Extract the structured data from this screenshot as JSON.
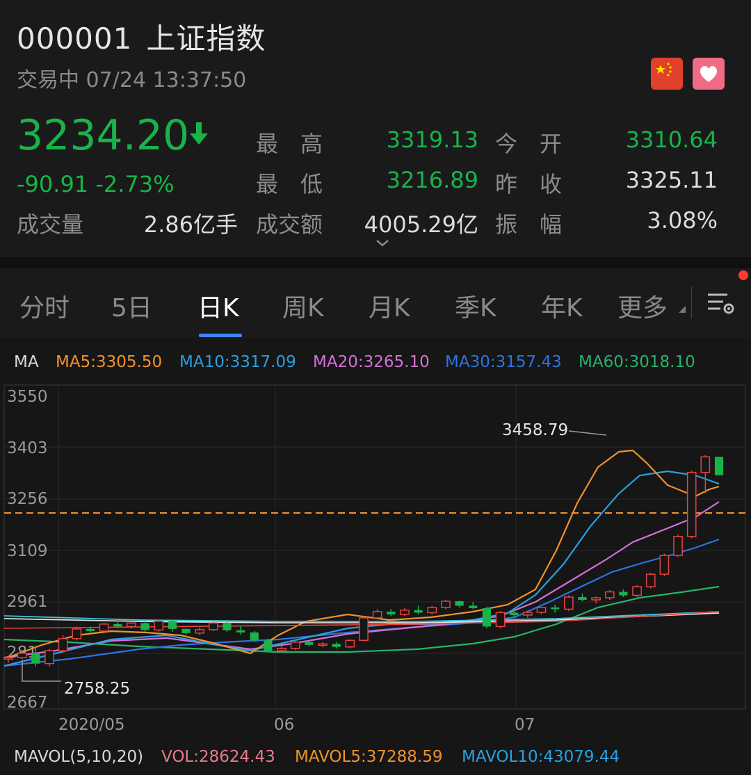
{
  "header": {
    "code": "000001",
    "name": "上证指数",
    "status": "交易中 07/24 13:37:50",
    "price": "3234.20",
    "change": "-90.91",
    "change_pct": "-2.73%",
    "icons": {
      "flag": "china-flag-icon",
      "favorite": "heart-icon",
      "price_direction": "down-arrow-icon"
    },
    "stats": {
      "high_label": "最　高",
      "high_value": "3319.13",
      "open_label": "今　开",
      "open_value": "3310.64",
      "low_label": "最　低",
      "low_value": "3216.89",
      "prev_close_label": "昨　收",
      "prev_close_value": "3325.11",
      "volume_label": "成交量",
      "volume_value": "2.86亿手",
      "turnover_label": "成交额",
      "turnover_value": "4005.29亿",
      "amplitude_label": "振　幅",
      "amplitude_value": "3.08%"
    }
  },
  "tabs": {
    "items": [
      "分时",
      "5日",
      "日K",
      "周K",
      "月K",
      "季K",
      "年K",
      "更多"
    ],
    "active": "日K"
  },
  "ma": {
    "label": "MA",
    "ma5": "MA5:3305.50",
    "ma10": "MA10:3317.09",
    "ma20": "MA20:3265.10",
    "ma30": "MA30:3157.43",
    "ma60": "MA60:3018.10"
  },
  "volume": {
    "label": "MAVOL(5,10,20)",
    "vol": "VOL:28624.43",
    "mavol5": "MAVOL5:37288.59",
    "mavol10": "MAVOL10:43079.44"
  },
  "colors": {
    "up": "#e8413c",
    "down": "#19b34a",
    "ma5": "#f0922c",
    "ma10": "#2a9fe0",
    "ma20": "#d66fd8",
    "ma30": "#2c74e0",
    "ma60": "#27b36b",
    "accent": "#3d86ff"
  },
  "chart_data": {
    "type": "candlestick",
    "y_ticks": [
      "3550",
      "3403",
      "3256",
      "3109",
      "2961",
      "281",
      "2667"
    ],
    "x_ticks": [
      "2020/05",
      "06",
      "07"
    ],
    "ylim": [
      2667,
      3550
    ],
    "annotations": {
      "high": "3458.79",
      "low": "2758.25"
    },
    "current_price": 3234.2,
    "ohlc": [
      [
        2792,
        2800,
        2780,
        2795
      ],
      [
        2795,
        2815,
        2790,
        2808
      ],
      [
        2808,
        2830,
        2770,
        2778
      ],
      [
        2778,
        2820,
        2770,
        2815
      ],
      [
        2815,
        2860,
        2810,
        2850
      ],
      [
        2850,
        2885,
        2845,
        2878
      ],
      [
        2878,
        2885,
        2868,
        2872
      ],
      [
        2872,
        2895,
        2865,
        2892
      ],
      [
        2892,
        2902,
        2880,
        2885
      ],
      [
        2885,
        2900,
        2878,
        2895
      ],
      [
        2895,
        2900,
        2870,
        2875
      ],
      [
        2875,
        2905,
        2870,
        2900
      ],
      [
        2900,
        2905,
        2870,
        2878
      ],
      [
        2878,
        2880,
        2862,
        2866
      ],
      [
        2866,
        2882,
        2860,
        2876
      ],
      [
        2876,
        2898,
        2872,
        2895
      ],
      [
        2895,
        2898,
        2870,
        2874
      ],
      [
        2874,
        2886,
        2862,
        2868
      ],
      [
        2868,
        2872,
        2840,
        2845
      ],
      [
        2845,
        2850,
        2810,
        2815
      ],
      [
        2815,
        2828,
        2810,
        2822
      ],
      [
        2822,
        2845,
        2818,
        2840
      ],
      [
        2840,
        2842,
        2828,
        2832
      ],
      [
        2832,
        2840,
        2825,
        2835
      ],
      [
        2835,
        2840,
        2822,
        2826
      ],
      [
        2826,
        2848,
        2822,
        2845
      ],
      [
        2845,
        2915,
        2842,
        2910
      ],
      [
        2910,
        2935,
        2905,
        2928
      ],
      [
        2928,
        2935,
        2915,
        2920
      ],
      [
        2920,
        2938,
        2915,
        2932
      ],
      [
        2932,
        2945,
        2920,
        2925
      ],
      [
        2925,
        2945,
        2920,
        2940
      ],
      [
        2940,
        2962,
        2935,
        2958
      ],
      [
        2958,
        2960,
        2940,
        2945
      ],
      [
        2945,
        2955,
        2935,
        2938
      ],
      [
        2938,
        2942,
        2880,
        2885
      ],
      [
        2885,
        2930,
        2880,
        2925
      ],
      [
        2925,
        2935,
        2912,
        2918
      ],
      [
        2918,
        2930,
        2910,
        2926
      ],
      [
        2926,
        2942,
        2920,
        2940
      ],
      [
        2940,
        2948,
        2925,
        2935
      ],
      [
        2935,
        2975,
        2930,
        2970
      ],
      [
        2970,
        2980,
        2958,
        2962
      ],
      [
        2962,
        2972,
        2952,
        2968
      ],
      [
        2968,
        2990,
        2962,
        2985
      ],
      [
        2985,
        2992,
        2970,
        2975
      ],
      [
        2975,
        3005,
        2970,
        3000
      ],
      [
        3000,
        3040,
        2995,
        3036
      ],
      [
        3036,
        3095,
        3030,
        3090
      ],
      [
        3090,
        3150,
        3085,
        3145
      ],
      [
        3145,
        3335,
        3140,
        3330
      ],
      [
        3330,
        3380,
        3270,
        3375
      ],
      [
        3375,
        3320,
        3360,
        3322
      ]
    ]
  }
}
